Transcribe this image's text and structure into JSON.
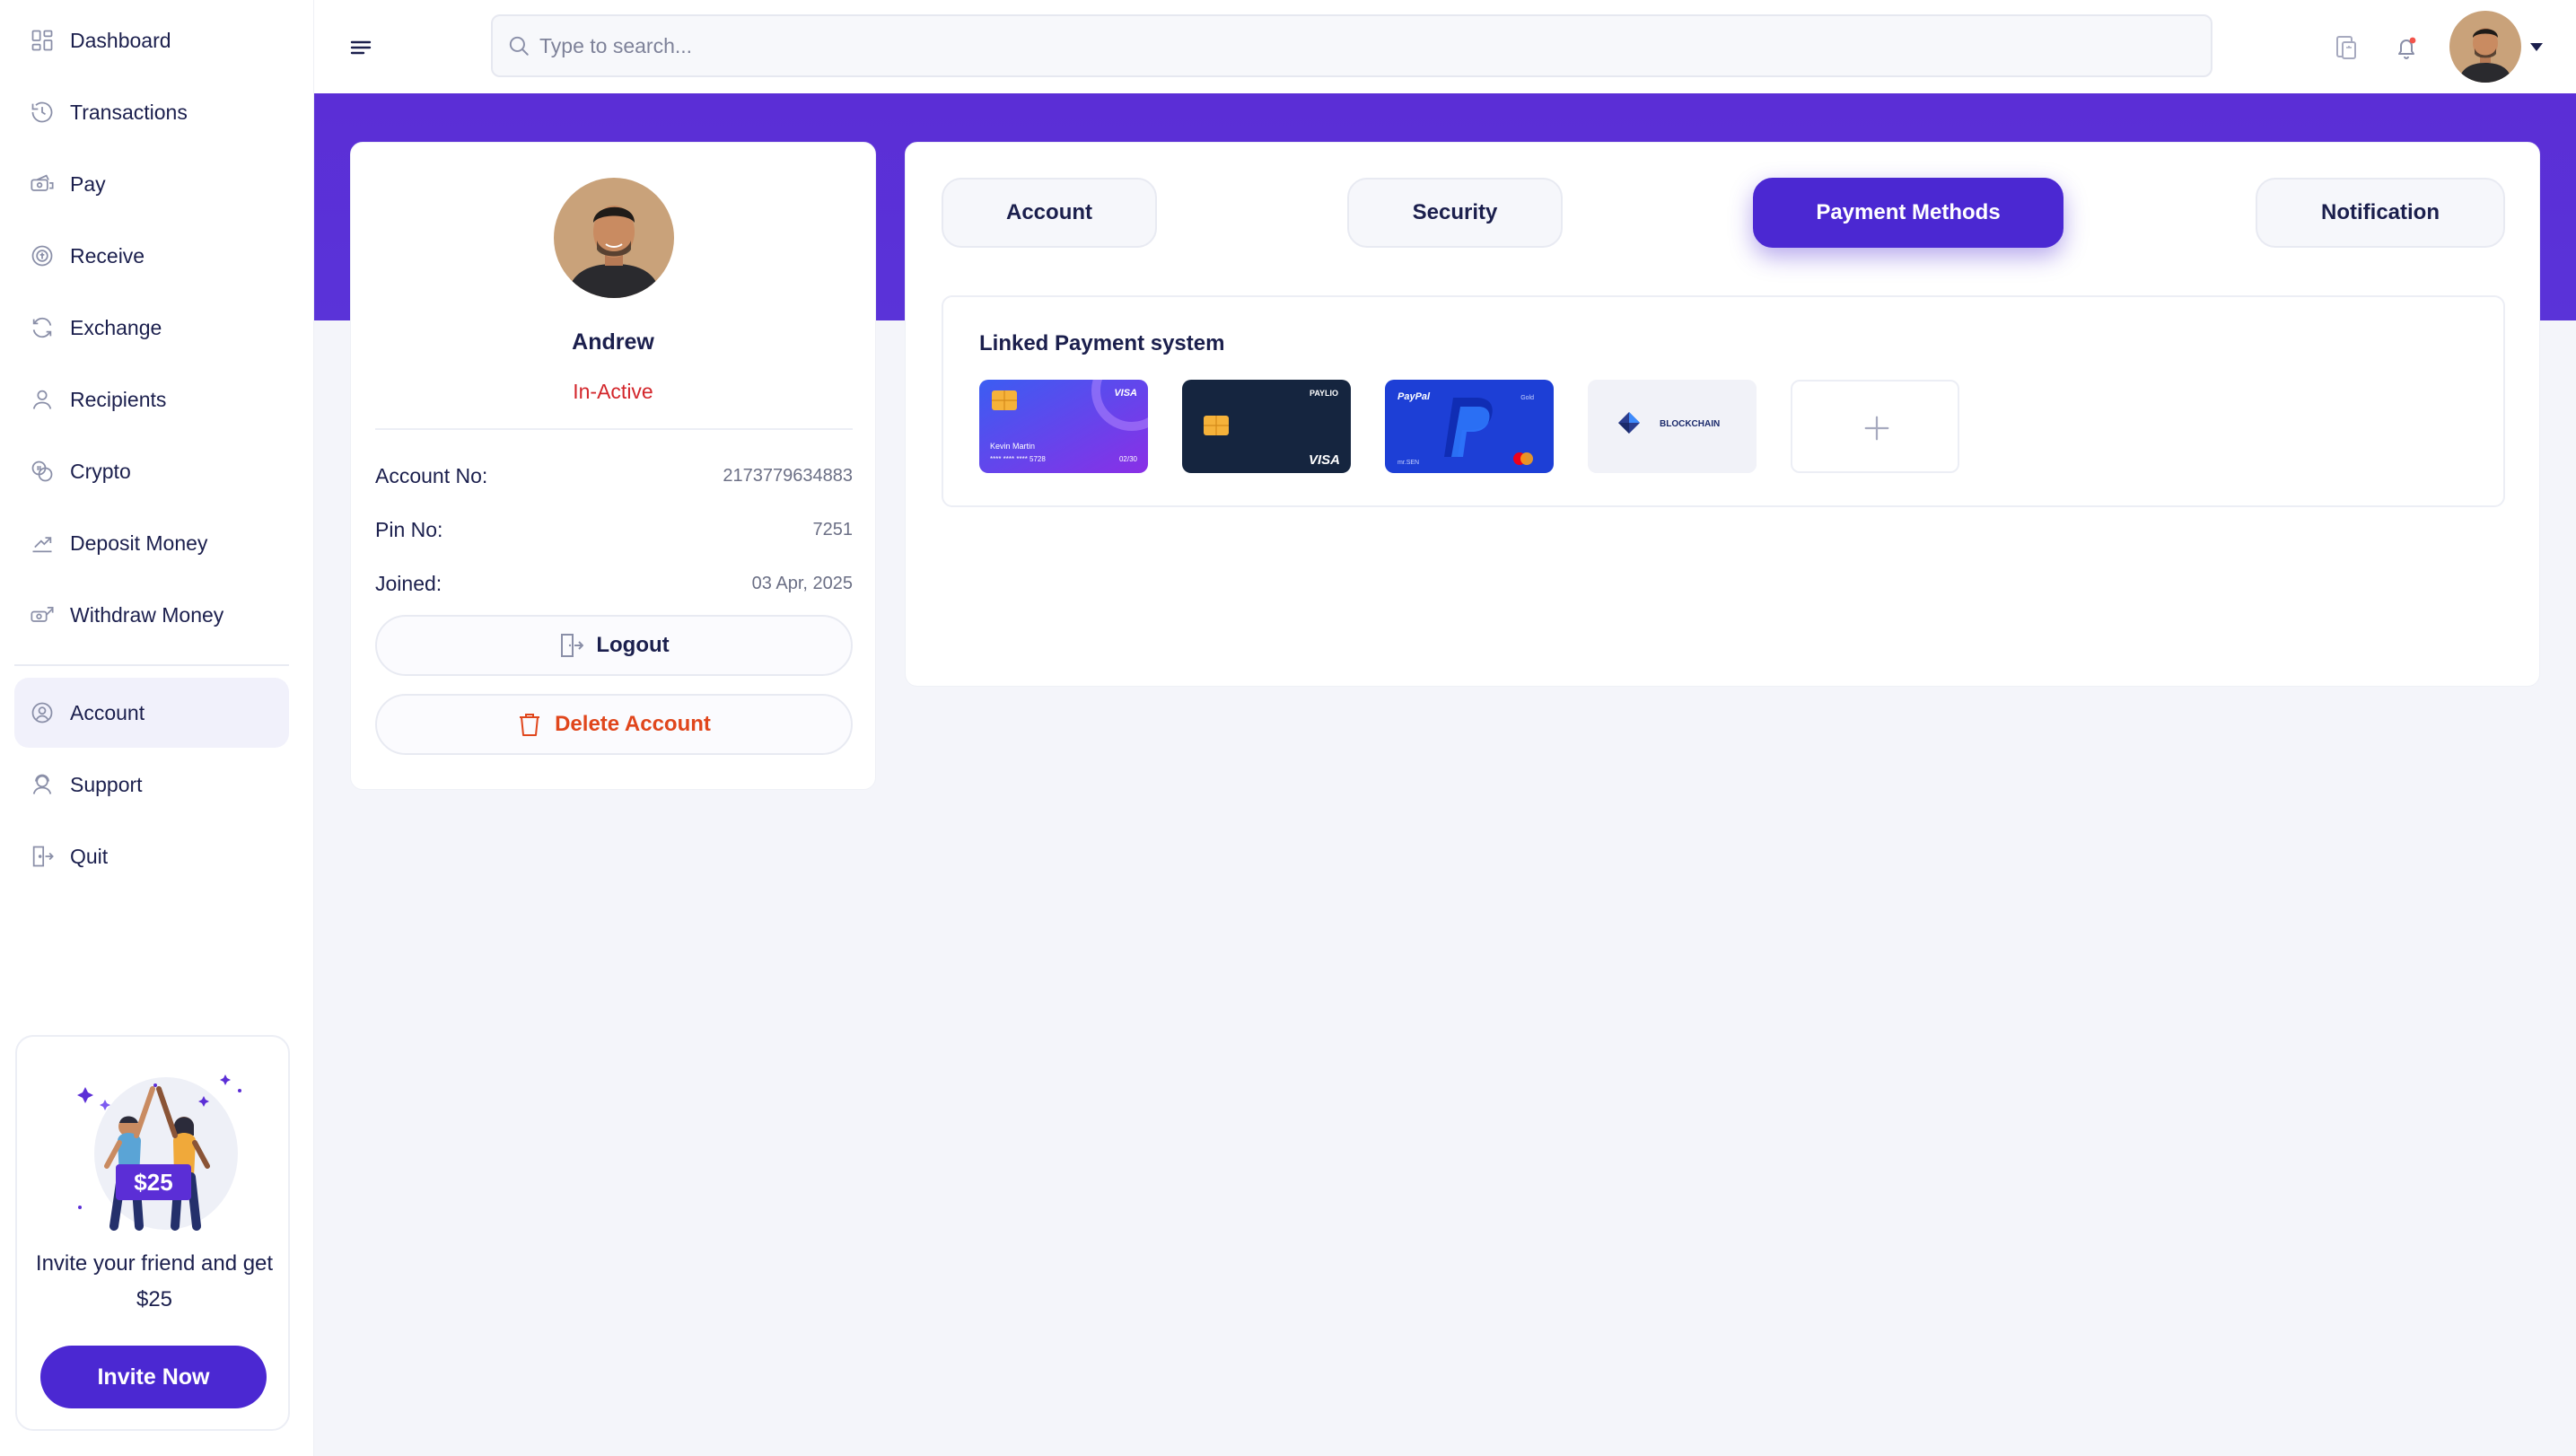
{
  "sidebar": {
    "items": [
      {
        "label": "Dashboard",
        "icon": "dashboard-icon"
      },
      {
        "label": "Transactions",
        "icon": "history-icon"
      },
      {
        "label": "Pay",
        "icon": "pay-icon"
      },
      {
        "label": "Receive",
        "icon": "receive-icon"
      },
      {
        "label": "Exchange",
        "icon": "exchange-icon"
      },
      {
        "label": "Recipients",
        "icon": "user-icon"
      },
      {
        "label": "Crypto",
        "icon": "crypto-icon"
      },
      {
        "label": "Deposit Money",
        "icon": "deposit-icon"
      },
      {
        "label": "Withdraw Money",
        "icon": "withdraw-icon"
      }
    ],
    "secondary": [
      {
        "label": "Account",
        "icon": "account-icon",
        "active": true
      },
      {
        "label": "Support",
        "icon": "support-icon"
      },
      {
        "label": "Quit",
        "icon": "quit-icon"
      }
    ],
    "promo": {
      "badge": "$25",
      "text": "Invite your friend and get $25",
      "button": "Invite Now"
    }
  },
  "header": {
    "search_placeholder": "Type to search..."
  },
  "profile": {
    "name": "Andrew",
    "status": "In-Active",
    "rows": [
      {
        "key": "Account No:",
        "value": "2173779634883"
      },
      {
        "key": "Pin No:",
        "value": "7251"
      },
      {
        "key": "Joined:",
        "value": "03 Apr, 2025"
      }
    ],
    "logout_label": "Logout",
    "delete_label": "Delete Account"
  },
  "tabs": [
    {
      "label": "Account"
    },
    {
      "label": "Security"
    },
    {
      "label": "Payment Methods",
      "active": true
    },
    {
      "label": "Notification"
    }
  ],
  "payment": {
    "title": "Linked Payment system",
    "cards": [
      {
        "type": "visa-card",
        "brand": "VISA",
        "holder": "Kevin Martin",
        "number": "**** **** **** 5728",
        "expiry": "02/30"
      },
      {
        "type": "paylio-card",
        "brand": "PAYLIO",
        "network": "VISA"
      },
      {
        "type": "paypal-card",
        "brand": "PayPal",
        "sub": "Gold",
        "holder": "mr.SEN"
      },
      {
        "type": "blockchain-card",
        "brand": "BLOCKCHAIN"
      }
    ],
    "add_icon": "plus-icon"
  },
  "colors": {
    "accent": "#4b28d2",
    "banner": "#5b2ed6",
    "danger": "#d3262b",
    "text": "#1b1f4d"
  }
}
